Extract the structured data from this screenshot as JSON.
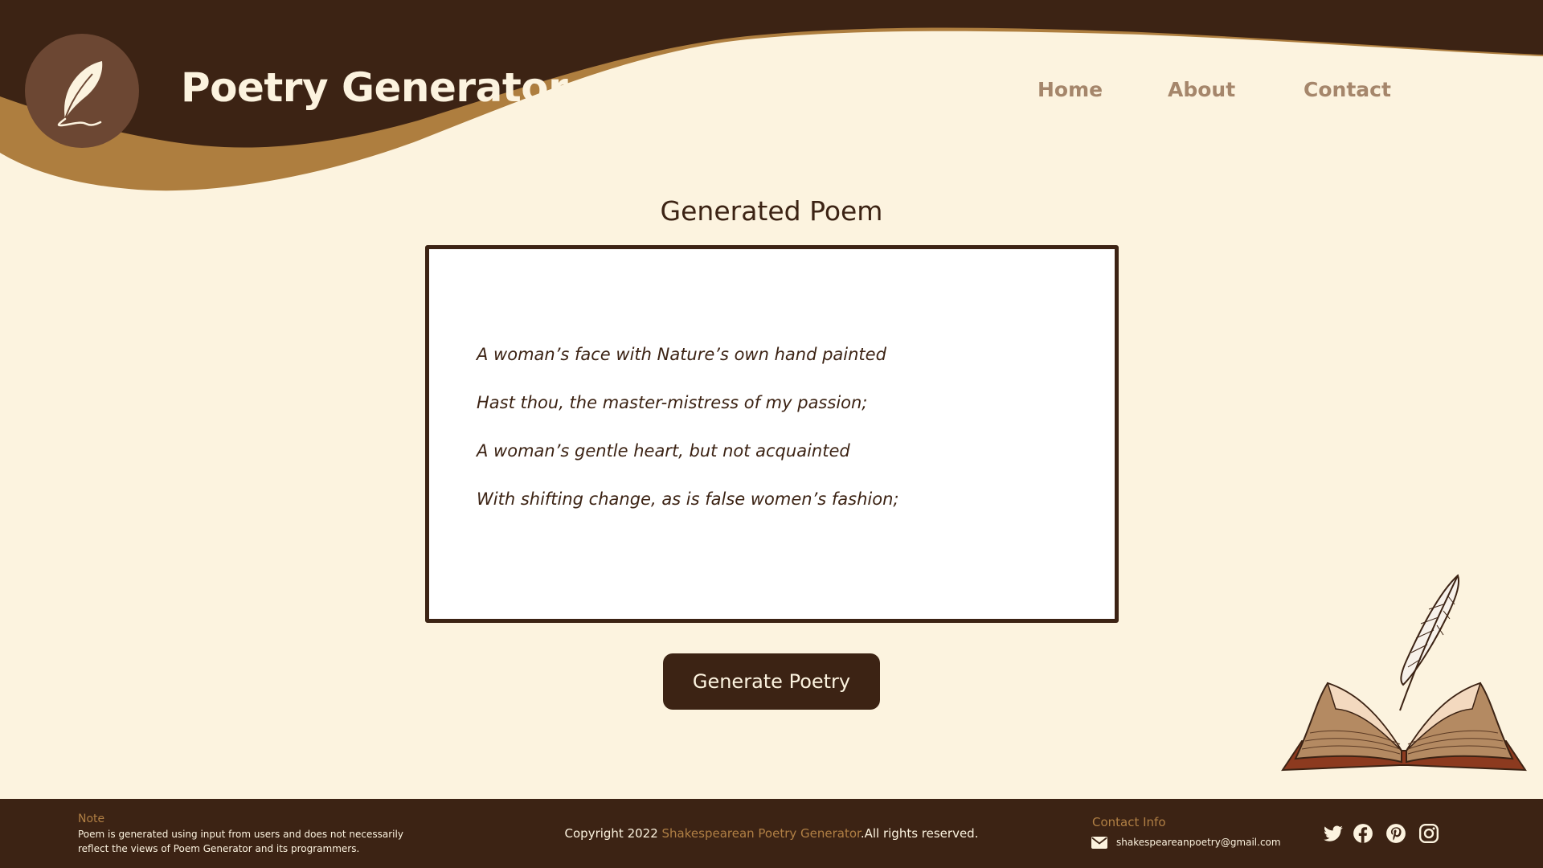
{
  "header": {
    "title": "Poetry Generator",
    "nav": [
      {
        "label": "Home"
      },
      {
        "label": "About"
      },
      {
        "label": "Contact"
      }
    ]
  },
  "main": {
    "section_title": "Generated Poem",
    "poem_lines": [
      "A woman’s face with Nature’s own hand painted",
      "Hast thou, the master-mistress of my passion;",
      "A woman’s gentle heart, but not acquainted",
      "With shifting change, as is false women’s fashion;"
    ],
    "generate_button": "Generate Poetry"
  },
  "footer": {
    "note_label": "Note",
    "note_text": "Poem is generated using input from users and does not necessarily reflect the views of Poem Generator and its programmers.",
    "copyright_prefix": "Copyright 2022 ",
    "copyright_brand": "Shakespearean Poetry Generator",
    "copyright_suffix": ".All rights reserved.",
    "contact_label": "Contact Info",
    "contact_email": "shakespeareanpoetry@gmail.com",
    "social_icons": [
      "twitter-icon",
      "facebook-icon",
      "pinterest-icon",
      "instagram-icon"
    ]
  },
  "colors": {
    "background": "#fcf3df",
    "dark_brown": "#3c2314",
    "gold": "#b07f44",
    "nav_text": "#a5866b",
    "logo_circle": "#6c4733"
  }
}
